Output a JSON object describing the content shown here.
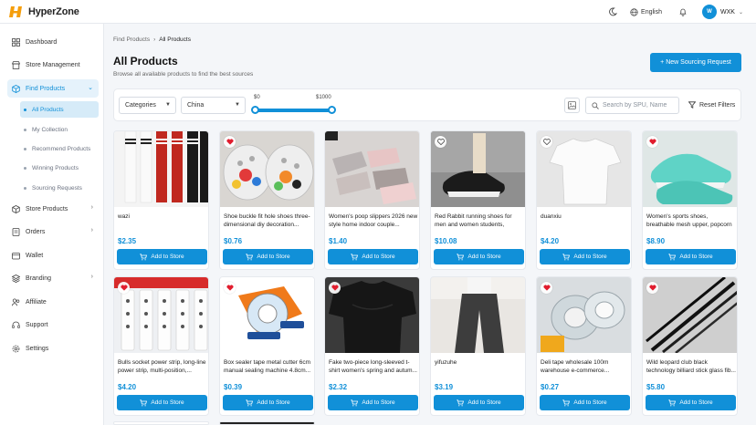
{
  "brand": {
    "name": "HyperZone"
  },
  "header": {
    "language": "English",
    "avatar_initial": "W",
    "user_name": "WXK"
  },
  "sidebar": {
    "items": [
      {
        "label": "Dashboard",
        "icon": "dashboard-icon"
      },
      {
        "label": "Store Management",
        "icon": "store-icon"
      },
      {
        "label": "Find Products",
        "icon": "box-icon",
        "active": true
      },
      {
        "label": "Store Products",
        "icon": "box-icon"
      },
      {
        "label": "Orders",
        "icon": "orders-icon"
      },
      {
        "label": "Wallet",
        "icon": "wallet-icon"
      },
      {
        "label": "Branding",
        "icon": "branding-icon"
      },
      {
        "label": "Affiliate",
        "icon": "affiliate-icon"
      },
      {
        "label": "Support",
        "icon": "support-icon"
      },
      {
        "label": "Settings",
        "icon": "settings-icon"
      }
    ],
    "sub_items": [
      {
        "label": "All Products",
        "active": true
      },
      {
        "label": "My Collection"
      },
      {
        "label": "Recommend Products"
      },
      {
        "label": "Winning Products"
      },
      {
        "label": "Sourcing Requests"
      }
    ]
  },
  "main": {
    "breadcrumb": {
      "parent": "Find Products",
      "current": "All Products"
    },
    "title": "All Products",
    "subtitle": "Browse all available products to find the best sources",
    "new_request_label": "+ New Sourcing Request",
    "filters": {
      "category_label": "Categories",
      "country_label": "China",
      "price_min": "$0",
      "price_max": "$1000",
      "price_range_fraction": [
        0,
        1
      ],
      "search_placeholder": "Search by SPU, Name",
      "reset_label": "Reset Filters"
    },
    "add_label": "Add to Store",
    "products": [
      {
        "name": "wazi",
        "price": "$2.35",
        "favorited": false
      },
      {
        "name": "Shoe buckle fit hole shoes three-dimensional diy decoration...",
        "price": "$0.76",
        "favorited": true
      },
      {
        "name": "Women's poop slippers 2026 new style home indoor couple...",
        "price": "$1.40",
        "favorited": false
      },
      {
        "name": "Red Rabbit running shoes for men and women students, marathon...",
        "price": "$10.08",
        "favorited": false
      },
      {
        "name": "duanxiu",
        "price": "$4.20",
        "favorited": false
      },
      {
        "name": "Women's sports shoes, breathable mesh upper, popcorn composite...",
        "price": "$8.90",
        "favorited": true
      },
      {
        "name": "Bulls socket power strip, long-line power strip, multi-position,...",
        "price": "$4.20",
        "favorited": true
      },
      {
        "name": "Box sealer tape metal cutter 6cm manual sealing machine 4.8cm...",
        "price": "$0.39",
        "favorited": true
      },
      {
        "name": "Fake two-piece long-sleeved t-shirt women's spring and autum...",
        "price": "$2.32",
        "favorited": true
      },
      {
        "name": "yifuzuhe",
        "price": "$3.19",
        "favorited": false
      },
      {
        "name": "Deli tape wholesale 100m warehouse e-commerce...",
        "price": "$0.27",
        "favorited": true
      },
      {
        "name": "Wild leopard club black technology billiard stick glass fib...",
        "price": "$5.80",
        "favorited": true
      }
    ]
  },
  "colors": {
    "accent": "#1190d8",
    "heart": "#e11d2e"
  }
}
